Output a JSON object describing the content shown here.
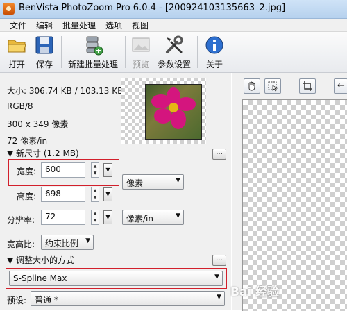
{
  "window": {
    "title": "BenVista PhotoZoom Pro 6.0.4 - [200924103135663_2.jpg]"
  },
  "menu": [
    "文件",
    "编辑",
    "批量处理",
    "选项",
    "视图"
  ],
  "toolbar": {
    "open": "打开",
    "save": "保存",
    "new_batch": "新建批量处理",
    "preview": "预览",
    "settings": "参数设置",
    "about": "关于"
  },
  "info": {
    "size": "大小: 306.74 KB / 103.13 KB",
    "color_mode": "RGB/8",
    "dimensions": "300 x 349 像素",
    "resolution": "72 像素/in"
  },
  "new_size": {
    "header": "▼ 新尺寸 (1.2 MB)",
    "more_button": "...",
    "width_label": "宽度:",
    "width_value": "600",
    "height_label": "高度:",
    "height_value": "698",
    "size_unit": "像素",
    "resolution_label": "分辨率:",
    "resolution_value": "72",
    "resolution_unit": "像素/in",
    "aspect_label": "宽高比:",
    "aspect_value": "约束比例"
  },
  "resize_method": {
    "header": "▼ 调整大小的方式",
    "more_button": "...",
    "method": "S-Spline Max",
    "preset_label": "预设:",
    "preset_value": "普通 *"
  },
  "watermark": "Bai 经验",
  "colors": {
    "highlight": "#d21f2b",
    "flower": "#d4157e"
  }
}
